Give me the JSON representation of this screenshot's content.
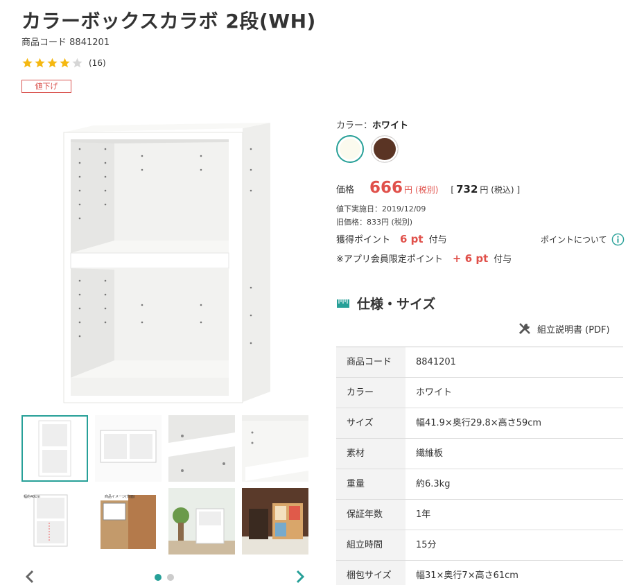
{
  "product": {
    "title": "カラーボックスカラボ 2段(WH)",
    "code_label": "商品コード",
    "code": "8841201",
    "rating_stars": 4,
    "rating_count": "(16)",
    "badge": "値下げ"
  },
  "gallery": {
    "thumbnails": [
      "thumb-1",
      "thumb-2",
      "thumb-3",
      "thumb-4",
      "thumb-5",
      "thumb-6",
      "thumb-7",
      "thumb-8"
    ],
    "thumb5_label": "幅約40cm",
    "thumb6_label": "商品イメージ(背面)",
    "active_index": 0,
    "dot_count": 2
  },
  "color": {
    "label": "カラー：",
    "selected": "ホワイト",
    "swatches": [
      "#fbfaee",
      "#5a3424"
    ]
  },
  "price": {
    "label": "価格",
    "amount": "666",
    "yen": "円",
    "tax_excl": "(税別)",
    "bracket_open": "[",
    "incl_amount": "732",
    "incl_suffix": "円 (税込)",
    "bracket_close": "]",
    "reduced_date": "値下実施日：2019/12/09",
    "old_price": "旧価格：833円 (税別)"
  },
  "points": {
    "label": "獲得ポイント",
    "value": "6 pt",
    "suffix": "付与",
    "app_label": "※アプリ会員限定ポイント",
    "app_value": "+ 6 pt",
    "app_suffix": "付与",
    "about_link": "ポイントについて"
  },
  "spec": {
    "heading": "仕様・サイズ",
    "manual_link": "組立説明書 (PDF)",
    "rows": [
      {
        "key": "商品コード",
        "value": "8841201"
      },
      {
        "key": "カラー",
        "value": "ホワイト"
      },
      {
        "key": "サイズ",
        "value": "幅41.9×奥行29.8×高さ59cm"
      },
      {
        "key": "素材",
        "value": "繊維板"
      },
      {
        "key": "重量",
        "value": "約6.3kg"
      },
      {
        "key": "保証年数",
        "value": "1年"
      },
      {
        "key": "組立時間",
        "value": "15分"
      },
      {
        "key": "梱包サイズ",
        "value": "幅31×奥行7×高さ61cm"
      }
    ]
  },
  "colors": {
    "accent": "#27a098",
    "price_red": "#e0504a",
    "star_gold": "#f5b811"
  }
}
